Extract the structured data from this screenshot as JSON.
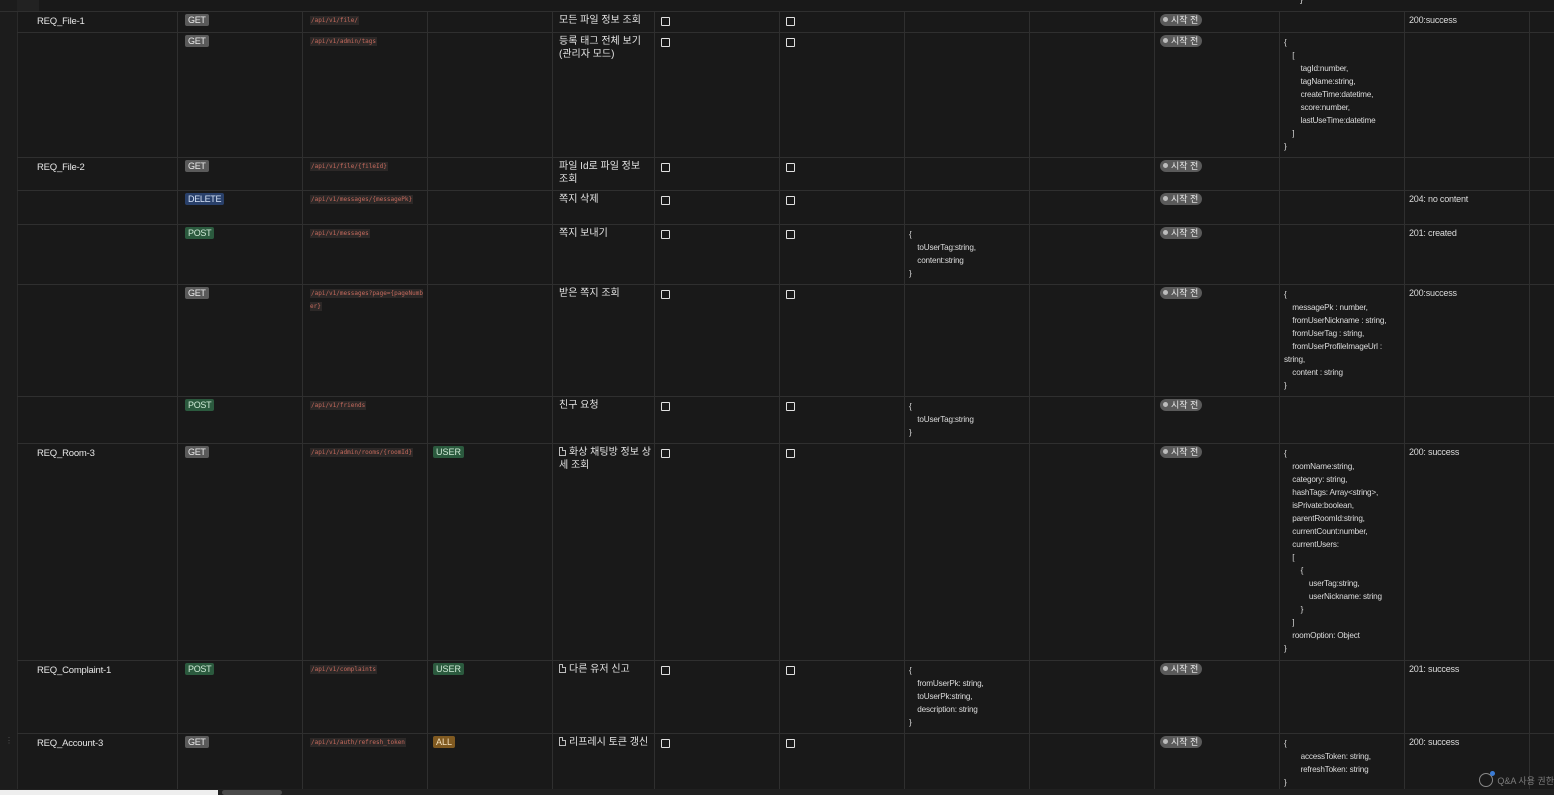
{
  "status_badge": "시작 전",
  "top_fragment": "}",
  "qa_button_label": "Q&A 사용 권한",
  "rows": [
    {
      "req_id": "REQ_File-1",
      "method": "GET",
      "url": "/api/v1/file/",
      "role": "",
      "description": "모든 파일 정보 조회",
      "has_page_icon": false,
      "request_body": "",
      "response_status": "200:success",
      "response_body": ""
    },
    {
      "req_id": "",
      "method": "GET",
      "url": "/api/v1/admin/tags",
      "role": "",
      "description": "등록 태그 전체 보기 (관리자 모드)",
      "has_page_icon": false,
      "request_body": "",
      "response_status": "",
      "response_body": "{\n    [\n        tagId:number,\n        tagName:string,\n        createTime:datetime,\n        score:number,\n        lastUseTime:datetime\n    ]\n}"
    },
    {
      "req_id": "REQ_File-2",
      "method": "GET",
      "url": "/api/v1/file/{fileId}",
      "role": "",
      "description": "파일 Id로 파일 정보 조회",
      "has_page_icon": false,
      "request_body": "",
      "response_status": "",
      "response_body": ""
    },
    {
      "req_id": "",
      "method": "DELETE",
      "url": "/api/v1/messages/{messagePk}",
      "role": "",
      "description": "쪽지 삭제",
      "has_page_icon": false,
      "request_body": "",
      "response_status": "204: no content",
      "response_body": ""
    },
    {
      "req_id": "",
      "method": "POST",
      "url": "/api/v1/messages",
      "role": "",
      "description": "쪽지 보내기",
      "has_page_icon": false,
      "request_body": "{\n    toUserTag:string,\n    content:string\n}",
      "response_status": "201: created",
      "response_body": ""
    },
    {
      "req_id": "",
      "method": "GET",
      "url": "/api/v1/messages?page={pageNumber}",
      "role": "",
      "description": "받은 쪽지 조회",
      "has_page_icon": false,
      "request_body": "",
      "response_status": "200:success",
      "response_body": "{\n    messagePk : number,\n    fromUserNickname : string,\n    fromUserTag : string,\n    fromUserProfileImageUrl :\nstring,\n    content : string\n}"
    },
    {
      "req_id": "",
      "method": "POST",
      "url": "/api/v1/friends",
      "role": "",
      "description": "친구 요청",
      "has_page_icon": false,
      "request_body": "{\n    toUserTag:string\n}",
      "response_status": "",
      "response_body": ""
    },
    {
      "req_id": "REQ_Room-3",
      "method": "GET",
      "url": "/api/v1/admin/rooms/{roomId}",
      "role": "USER",
      "description": "화상 채팅방 정보 상세 조회",
      "has_page_icon": true,
      "request_body": "",
      "response_status": "200: success",
      "response_body": "{\n    roomName:string,\n    category: string,\n    hashTags: Array<string>,\n    isPrivate:boolean,\n    parentRoomId:string,\n    currentCount:number,\n    currentUsers:\n    [\n        {\n            userTag:string,\n            userNickname: string\n        }\n    ]\n    roomOption: Object\n}"
    },
    {
      "req_id": "REQ_Complaint-1",
      "method": "POST",
      "url": "/api/v1/complaints",
      "role": "USER",
      "description": "다른 유저 신고",
      "has_page_icon": true,
      "request_body": "{\n    fromUserPk: string,\n    toUserPk:string,\n    description: string\n}",
      "response_status": "201: success",
      "response_body": ""
    },
    {
      "req_id": "REQ_Account-3",
      "method": "GET",
      "url": "/api/v1/auth/refresh_token",
      "role": "ALL",
      "description": "리프레시 토큰 갱신",
      "has_page_icon": true,
      "request_body": "",
      "response_status": "200: success",
      "response_body": "{\n        accessToken: string,\n        refreshToken: string\n}"
    }
  ]
}
